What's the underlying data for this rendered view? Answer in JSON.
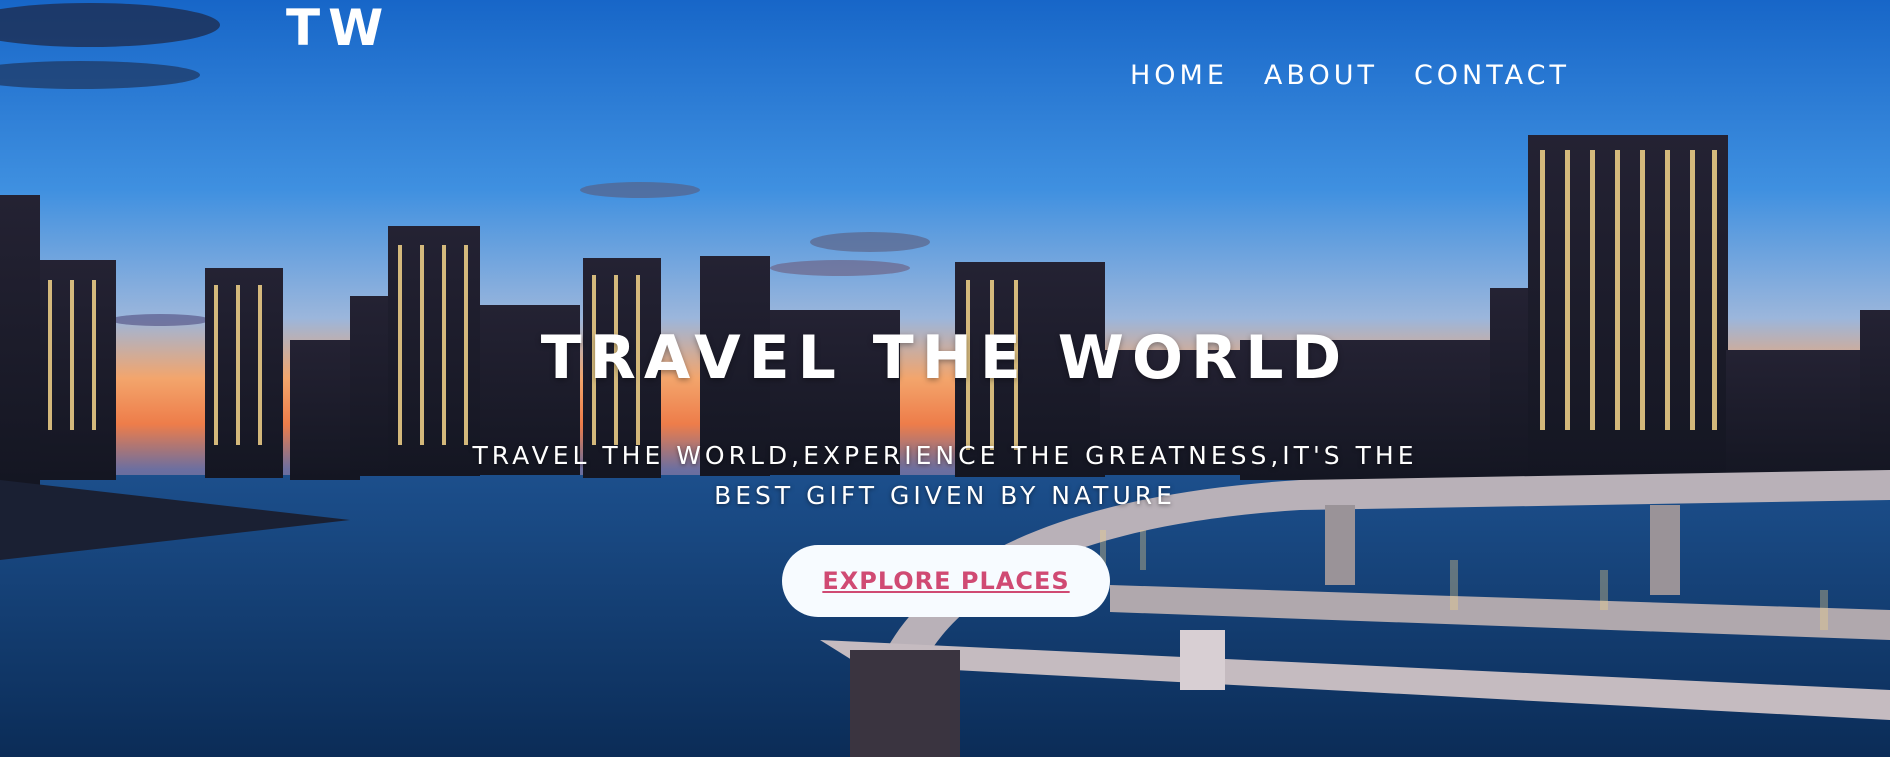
{
  "logo": "TW",
  "nav": {
    "items": [
      {
        "label": "HOME"
      },
      {
        "label": "ABOUT"
      },
      {
        "label": "CONTACT"
      }
    ]
  },
  "hero": {
    "title": "TRAVEL THE WORLD",
    "subtitle": "TRAVEL THE WORLD,EXPERIENCE THE GREATNESS,IT'S THE BEST GIFT GIVEN BY NATURE",
    "cta_label": "EXPLORE PLACES"
  },
  "colors": {
    "sky_top": "#1b6fd1",
    "sky_mid": "#5aa3e8",
    "sunset": "#f39a5e",
    "water": "#0e3a6b",
    "cta_bg": "#f7fbff",
    "cta_text": "#d04a73"
  }
}
